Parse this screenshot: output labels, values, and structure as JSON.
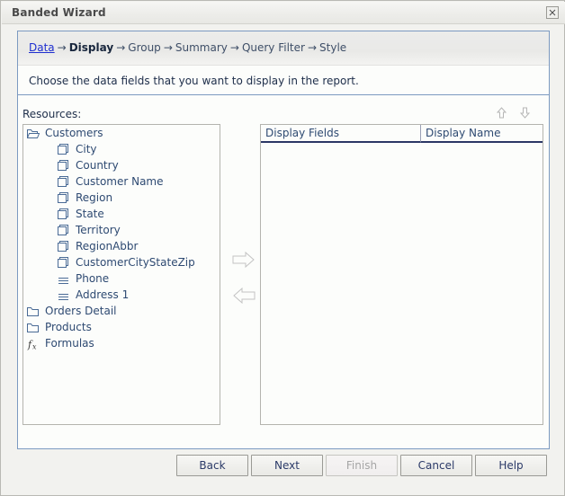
{
  "window": {
    "title": "Banded Wizard",
    "close_label": "✕",
    "close_icon": "close-icon"
  },
  "wizard": {
    "breadcrumb": [
      {
        "label": "Data",
        "state": "link"
      },
      {
        "label": "Display",
        "state": "current"
      },
      {
        "label": "Group",
        "state": "normal"
      },
      {
        "label": "Summary",
        "state": "normal"
      },
      {
        "label": "Query Filter",
        "state": "normal"
      },
      {
        "label": "Style",
        "state": "normal"
      }
    ],
    "separator": "→",
    "instruction": "Choose the data fields that you want to display in the report."
  },
  "resources": {
    "label": "Resources:",
    "tree": [
      {
        "label": "Customers",
        "icon": "folder-open-icon",
        "level": 0
      },
      {
        "label": "City",
        "icon": "sheet-icon",
        "level": 1
      },
      {
        "label": "Country",
        "icon": "sheet-icon",
        "level": 1
      },
      {
        "label": "Customer Name",
        "icon": "sheet-icon",
        "level": 1
      },
      {
        "label": "Region",
        "icon": "sheet-icon",
        "level": 1
      },
      {
        "label": "State",
        "icon": "sheet-icon",
        "level": 1
      },
      {
        "label": "Territory",
        "icon": "sheet-icon",
        "level": 1
      },
      {
        "label": "RegionAbbr",
        "icon": "sheet-icon",
        "level": 1
      },
      {
        "label": "CustomerCityStateZip",
        "icon": "sheet-icon",
        "level": 1
      },
      {
        "label": "Phone",
        "icon": "lines-icon",
        "level": 1
      },
      {
        "label": "Address 1",
        "icon": "lines-icon",
        "level": 1
      },
      {
        "label": "Orders Detail",
        "icon": "folder-icon",
        "level": 0
      },
      {
        "label": "Products",
        "icon": "folder-icon",
        "level": 0
      },
      {
        "label": "Formulas",
        "icon": "formula-icon",
        "level": 0
      }
    ]
  },
  "reorder": {
    "move_up_icon": "arrow-up-icon",
    "move_down_icon": "arrow-down-icon",
    "move_up_glyph": "⇧",
    "move_down_glyph": "⇩"
  },
  "transfer": {
    "add_icon": "arrow-right-icon",
    "remove_icon": "arrow-left-icon"
  },
  "display_fields": {
    "columns": [
      "Display Fields",
      "Display Name"
    ],
    "rows": []
  },
  "buttons": [
    {
      "label": "Back",
      "name": "back-button",
      "enabled": true
    },
    {
      "label": "Next",
      "name": "next-button",
      "enabled": true
    },
    {
      "label": "Finish",
      "name": "finish-button",
      "enabled": false
    },
    {
      "label": "Cancel",
      "name": "cancel-button",
      "enabled": true
    },
    {
      "label": "Help",
      "name": "help-button",
      "enabled": true
    }
  ],
  "colors": {
    "accent_border": "#7c9ac1",
    "link": "#1f2fd0",
    "tree_text": "#2e4a72",
    "header_underline": "#2b3765",
    "disabled": "#b6b6b6"
  }
}
